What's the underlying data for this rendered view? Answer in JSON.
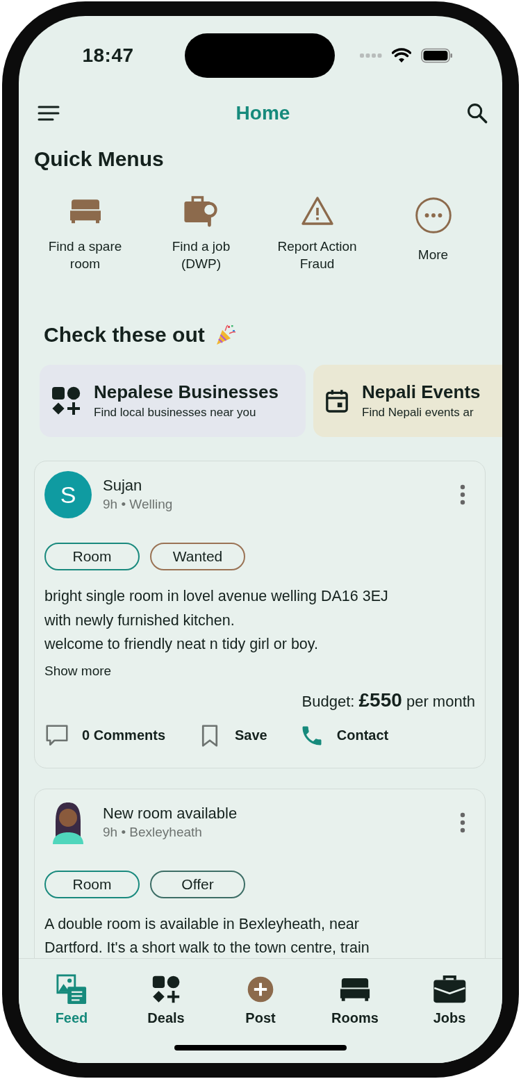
{
  "status_bar": {
    "time": "18:47"
  },
  "header": {
    "title": "Home"
  },
  "quick_menus": {
    "title": "Quick Menus",
    "items": [
      {
        "label": "Find a spare room",
        "kind": "bed"
      },
      {
        "label": "Find a job (DWP)",
        "kind": "job"
      },
      {
        "label": "Report Action Fraud",
        "kind": "warning"
      },
      {
        "label": "More",
        "kind": "more"
      }
    ]
  },
  "promos": {
    "title": "Check these out",
    "items": [
      {
        "title": "Nepalese Businesses",
        "subtitle": "Find local businesses near you",
        "kind": "apps",
        "color": "#e4e7ee"
      },
      {
        "title": "Nepali Events",
        "subtitle": "Find Nepali events ar",
        "kind": "calendar",
        "color": "#eae8d4"
      }
    ]
  },
  "posts": [
    {
      "avatar": {
        "kind": "letter",
        "letter": "S"
      },
      "name": "Sujan",
      "meta": "9h • Welling",
      "tags": [
        {
          "label": "Room",
          "color": "#1a8a7e"
        },
        {
          "label": "Wanted",
          "color": "#9a7355"
        }
      ],
      "body": "bright single room in lovel avenue welling DA16 3EJ\nwith newly furnished kitchen.\nwelcome to friendly neat n tidy girl or boy.",
      "show_more": "Show more",
      "budget": "Budget: **£550** per month",
      "actions": [
        {
          "kind": "comment",
          "label": "0 Comments"
        },
        {
          "kind": "save",
          "label": "Save"
        },
        {
          "kind": "contact",
          "label": "Contact"
        }
      ]
    },
    {
      "avatar": {
        "kind": "figure"
      },
      "name": "New room available",
      "meta": "9h • Bexleyheath",
      "tags": [
        {
          "label": "Room",
          "color": "#1a8a7e"
        },
        {
          "label": "Offer",
          "color": "#3d6e66"
        }
      ],
      "body": "A double room is available in Bexleyheath, near\nDartford. It's a short walk to the town centre, train"
    }
  ],
  "nav": {
    "items": [
      {
        "label": "Feed",
        "kind": "feed",
        "selected": true
      },
      {
        "label": "Deals",
        "kind": "deals",
        "selected": false
      },
      {
        "label": "Post",
        "kind": "post",
        "selected": false
      },
      {
        "label": "Rooms",
        "kind": "rooms",
        "selected": false
      },
      {
        "label": "Jobs",
        "kind": "jobs",
        "selected": false
      }
    ]
  }
}
